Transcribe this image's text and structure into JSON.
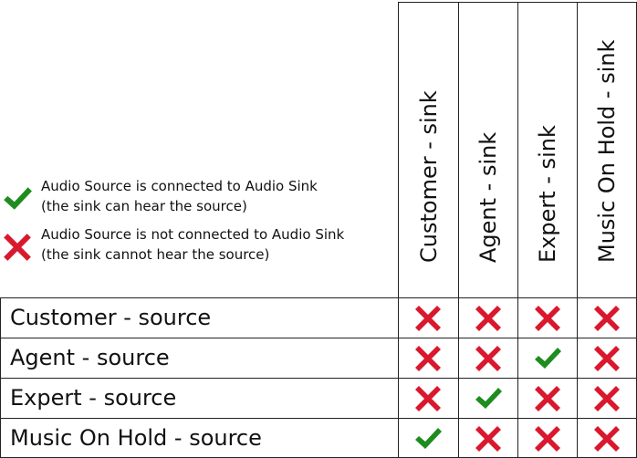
{
  "legend": {
    "connected": {
      "icon": "check-icon",
      "color": "#1e8c1e",
      "line1": "Audio Source is connected to Audio Sink",
      "line2": "(the sink can hear the source)"
    },
    "disconnected": {
      "icon": "cross-icon",
      "color": "#d9182e",
      "line1": "Audio Source is not connected to Audio Sink",
      "line2": "(the sink cannot hear the source)"
    }
  },
  "sinks": [
    "Customer - sink",
    "Agent - sink",
    "Expert - sink",
    "Music On Hold - sink"
  ],
  "sources": [
    {
      "label": "Customer - source",
      "connections": [
        false,
        false,
        false,
        false
      ]
    },
    {
      "label": "Agent - source",
      "connections": [
        false,
        false,
        true,
        false
      ]
    },
    {
      "label": "Expert - source",
      "connections": [
        false,
        true,
        false,
        false
      ]
    },
    {
      "label": "Music On Hold - source",
      "connections": [
        true,
        false,
        false,
        false
      ]
    }
  ]
}
